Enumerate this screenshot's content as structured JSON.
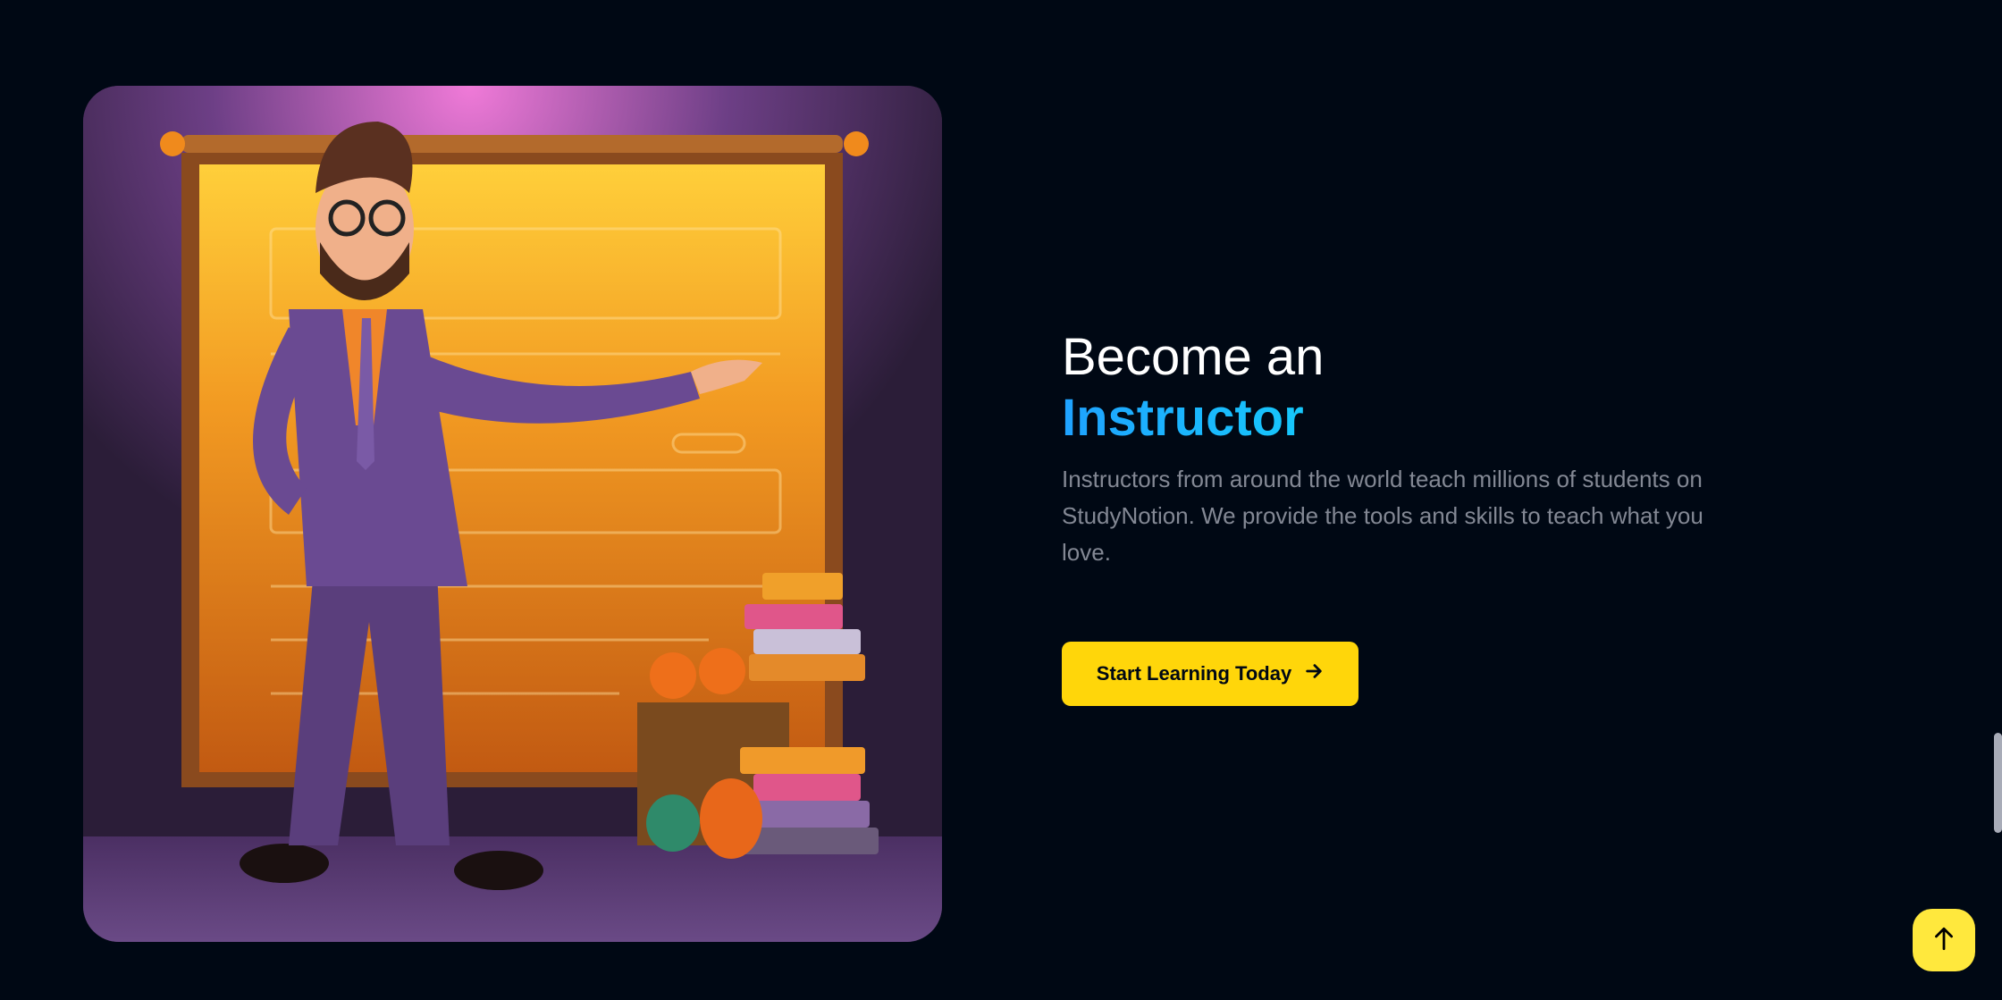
{
  "hero_image": {
    "alt": "Cartoon instructor presenting in front of an orange chalkboard"
  },
  "heading": {
    "line1": "Become an",
    "highlight": "Instructor"
  },
  "description": "Instructors from around the world teach millions of students on StudyNotion. We provide the tools and skills to teach what you love.",
  "cta": {
    "label": "Start Learning Today",
    "icon": "arrow-right-icon"
  },
  "scroll_top": {
    "icon": "arrow-up-icon"
  },
  "colors": {
    "background": "#000814",
    "accent": "#ffd60a",
    "text_muted": "#838894",
    "gradient": [
      "#1fa2ff",
      "#12d8fa",
      "#a6ffcb"
    ]
  }
}
